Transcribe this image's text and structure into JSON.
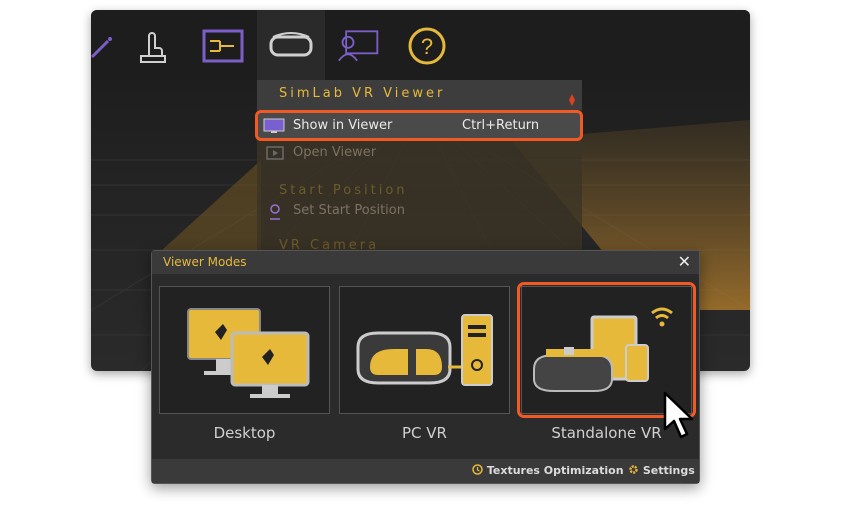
{
  "toolbar": {
    "icons": [
      "wand-icon",
      "hand-touch-icon",
      "path-flow-icon",
      "vr-headset-icon",
      "presentation-icon",
      "help-icon"
    ],
    "accent": "#e7b93a"
  },
  "menu": {
    "title": "SimLab VR Viewer",
    "show_in_viewer": "Show in Viewer",
    "show_in_viewer_shortcut": "Ctrl+Return",
    "open_viewer": "Open Viewer",
    "start_position_section": "Start Position",
    "set_start_position": "Set Start Position",
    "vr_camera_section": "VR Camera"
  },
  "dialog": {
    "title": "Viewer Modes",
    "close": "✕",
    "modes": [
      {
        "label": "Desktop"
      },
      {
        "label": "PC VR"
      },
      {
        "label": "Standalone VR"
      }
    ],
    "footer": {
      "textures": "Textures Optimization",
      "settings": "Settings"
    }
  },
  "colors": {
    "highlight": "#f15a24",
    "accent": "#e7b93a"
  }
}
